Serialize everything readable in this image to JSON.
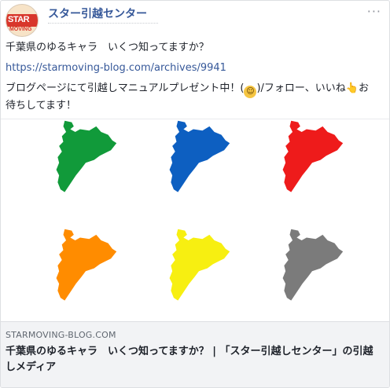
{
  "post": {
    "page_name": "スター引越センター",
    "more_icon": "more-dots-icon",
    "avatar": {
      "mark": "STAR",
      "sub": "MOVING"
    },
    "text_line1": "千葉県のゆるキャラ　いくつ知ってますか？",
    "link": "https://starmoving-blog.com/archives/9941",
    "text_line3_a": "ブログページにて引越しマニュアルプレゼント中！(",
    "text_line3_b": ")/フォロー、いいね",
    "text_line3_c": "お",
    "text_line4": "待ちしてます！",
    "emoji_icon": "smiling-face-icon",
    "emoji_glyph": "☺",
    "hand_icon": "pointing-hand-icon",
    "hand_glyph": "👆"
  },
  "image": {
    "maps": [
      {
        "color": "#119a3a"
      },
      {
        "color": "#0d5fc1"
      },
      {
        "color": "#ee1b1b"
      },
      {
        "color": "#ff8c00"
      },
      {
        "color": "#f7ef11"
      },
      {
        "color": "#7b7b7b"
      }
    ]
  },
  "preview": {
    "domain": "STARMOVING-BLOG.COM",
    "title": "千葉県のゆるキャラ　いくつ知ってますか？ | 「スター引越しセンター」の引越しメディア"
  }
}
